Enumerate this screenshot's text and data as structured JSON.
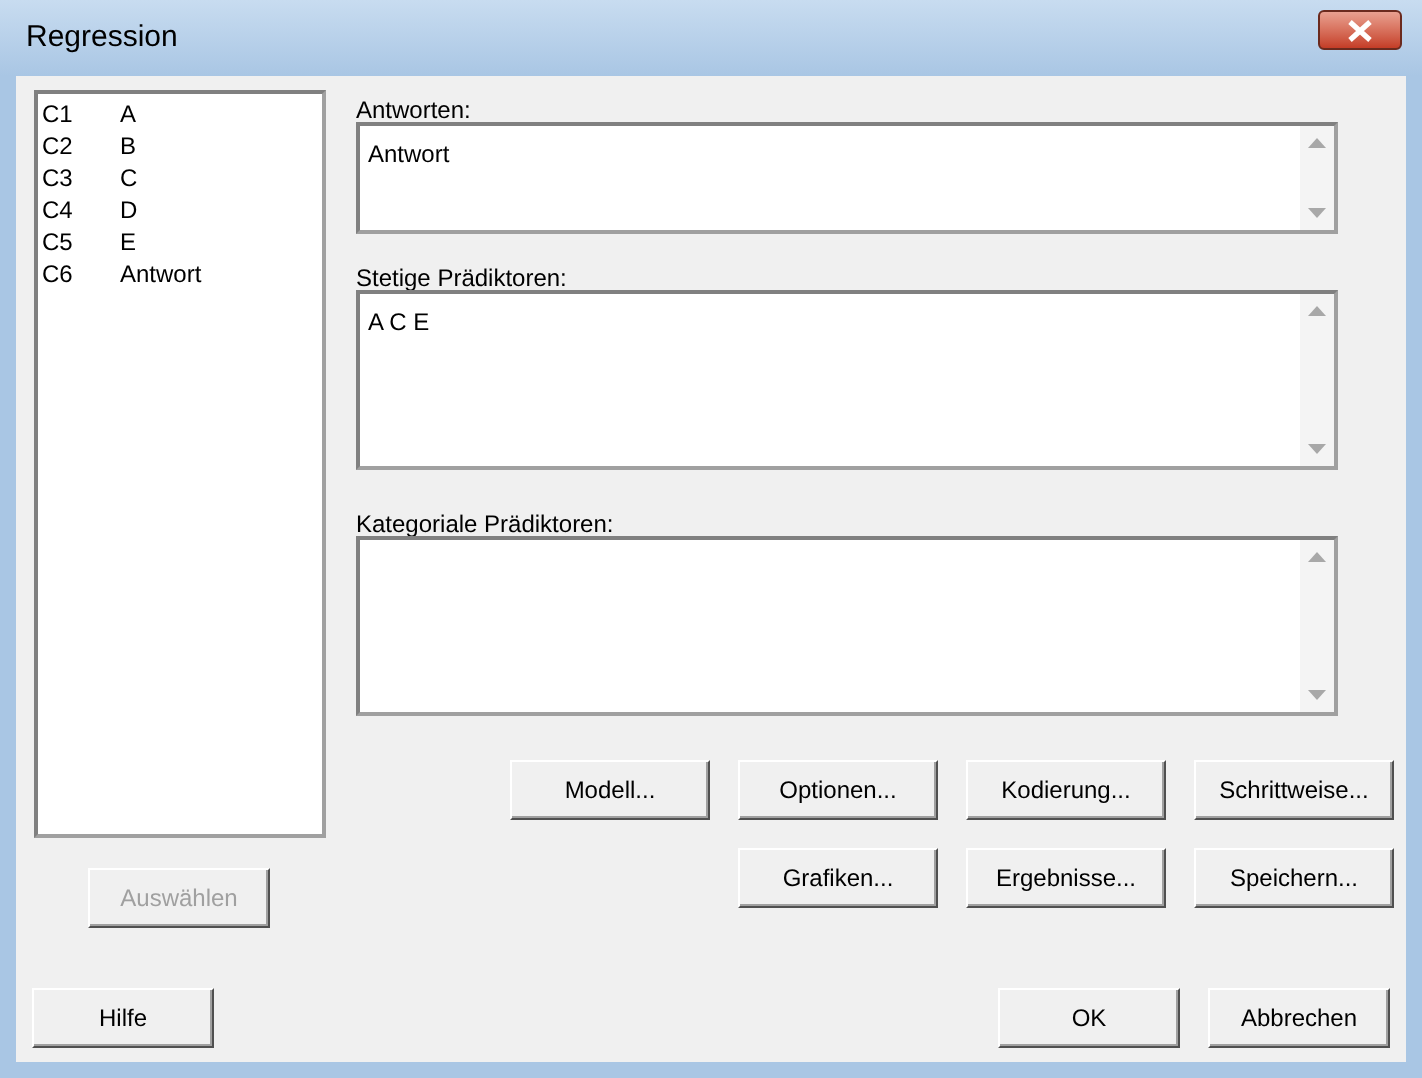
{
  "window": {
    "title": "Regression"
  },
  "variables": [
    {
      "column": "C1",
      "name": "A"
    },
    {
      "column": "C2",
      "name": "B"
    },
    {
      "column": "C3",
      "name": "C"
    },
    {
      "column": "C4",
      "name": "D"
    },
    {
      "column": "C5",
      "name": "E"
    },
    {
      "column": "C6",
      "name": "Antwort"
    }
  ],
  "fields": [
    {
      "label": "Antworten:",
      "value": "Antwort"
    },
    {
      "label": "Stetige Prädiktoren:",
      "value": "A C E"
    },
    {
      "label": "Kategoriale Prädiktoren:"
    }
  ],
  "select_button": {
    "label": "Auswählen",
    "disabled": true
  },
  "option_buttons": [
    {
      "label": "Modell..."
    },
    {
      "label": "Optionen..."
    },
    {
      "label": "Kodierung..."
    },
    {
      "label": "Schrittweise..."
    }
  ],
  "output_buttons": [
    {
      "label": "Grafiken..."
    },
    {
      "label": "Ergebnisse..."
    },
    {
      "label": "Speichern..."
    }
  ],
  "help_button": {
    "label": "Hilfe"
  },
  "dialog_buttons": [
    {
      "label": "OK"
    },
    {
      "label": "Abbrechen"
    }
  ]
}
